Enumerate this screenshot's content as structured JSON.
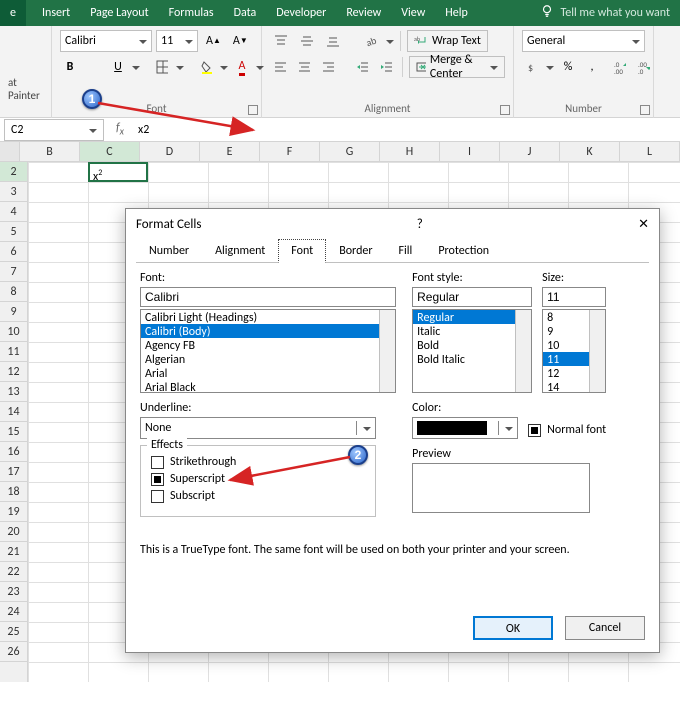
{
  "ribbon_tabs": {
    "file": "e",
    "insert": "Insert",
    "page_layout": "Page Layout",
    "formulas": "Formulas",
    "data": "Data",
    "developer": "Developer",
    "review": "Review",
    "view": "View",
    "help": "Help",
    "tellme": "Tell me what you want"
  },
  "clipboard": {
    "painter": "at Painter"
  },
  "font": {
    "name": "Calibri",
    "size": "11",
    "bold": "B",
    "underline": "U",
    "group_label": "Font"
  },
  "alignment": {
    "wrap": "Wrap Text",
    "merge": "Merge & Center",
    "group_label": "Alignment"
  },
  "number": {
    "format": "General",
    "group_label": "Number"
  },
  "cell": {
    "ref": "C2",
    "fx_value": "x2",
    "display_base": "x",
    "display_sup": "2"
  },
  "col_headers": [
    "B",
    "C",
    "D",
    "E",
    "F",
    "G",
    "H",
    "I",
    "J",
    "K",
    "L"
  ],
  "row_headers": [
    "2",
    "3",
    "4",
    "5",
    "6",
    "7",
    "8",
    "9",
    "10",
    "11",
    "12",
    "13",
    "14",
    "15",
    "16",
    "17",
    "18",
    "19",
    "20",
    "21",
    "22",
    "23",
    "24",
    "25",
    "26"
  ],
  "dialog": {
    "title": "Format Cells",
    "tabs": {
      "number": "Number",
      "alignment": "Alignment",
      "font": "Font",
      "border": "Border",
      "fill": "Fill",
      "protection": "Protection"
    },
    "font_label": "Font:",
    "font_value": "Calibri",
    "font_list": [
      "Calibri Light (Headings)",
      "Calibri (Body)",
      "Agency FB",
      "Algerian",
      "Arial",
      "Arial Black"
    ],
    "font_selected_index": 1,
    "style_label": "Font style:",
    "style_value": "Regular",
    "style_list": [
      "Regular",
      "Italic",
      "Bold",
      "Bold Italic"
    ],
    "style_selected_index": 0,
    "size_label": "Size:",
    "size_value": "11",
    "size_list": [
      "8",
      "9",
      "10",
      "11",
      "12",
      "14"
    ],
    "size_selected_index": 3,
    "underline_label": "Underline:",
    "underline_value": "None",
    "color_label": "Color:",
    "normal_font": "Normal font",
    "effects_label": "Effects",
    "strikethrough": "Strikethrough",
    "superscript": "Superscript",
    "subscript": "Subscript",
    "preview_label": "Preview",
    "note": "This is a TrueType font.  The same font will be used on both your printer and your screen.",
    "ok": "OK",
    "cancel": "Cancel",
    "help": "?",
    "close": "✕"
  },
  "callouts": {
    "one": "1",
    "two": "2"
  }
}
